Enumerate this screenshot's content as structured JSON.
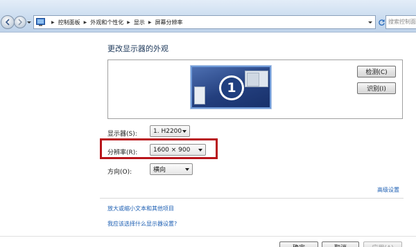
{
  "addressbar": {
    "breadcrumbs": [
      "控制面板",
      "外观和个性化",
      "显示",
      "屏幕分辨率"
    ],
    "search_placeholder": "搜索控制面板"
  },
  "main": {
    "title": "更改显示器的外观",
    "monitor_number": "1",
    "detect_button": "检测(C)",
    "identify_button": "识别(I)",
    "display_label": "显示器(S):",
    "display_value": "1. H2200",
    "resolution_label": "分辨率(R):",
    "resolution_value": "1600 × 900",
    "orientation_label": "方向(O):",
    "orientation_value": "横向",
    "advanced_link": "高级设置",
    "link_text_size": "放大或缩小文本和其他项目",
    "link_which_settings": "我应该选择什么显示器设置?"
  },
  "footer": {
    "ok_button": "确定",
    "cancel_button": "取消",
    "apply_button": "应用(A)"
  },
  "colors": {
    "highlight_box": "#b8141a",
    "link": "#1d5fb3",
    "title": "#1e395b"
  }
}
